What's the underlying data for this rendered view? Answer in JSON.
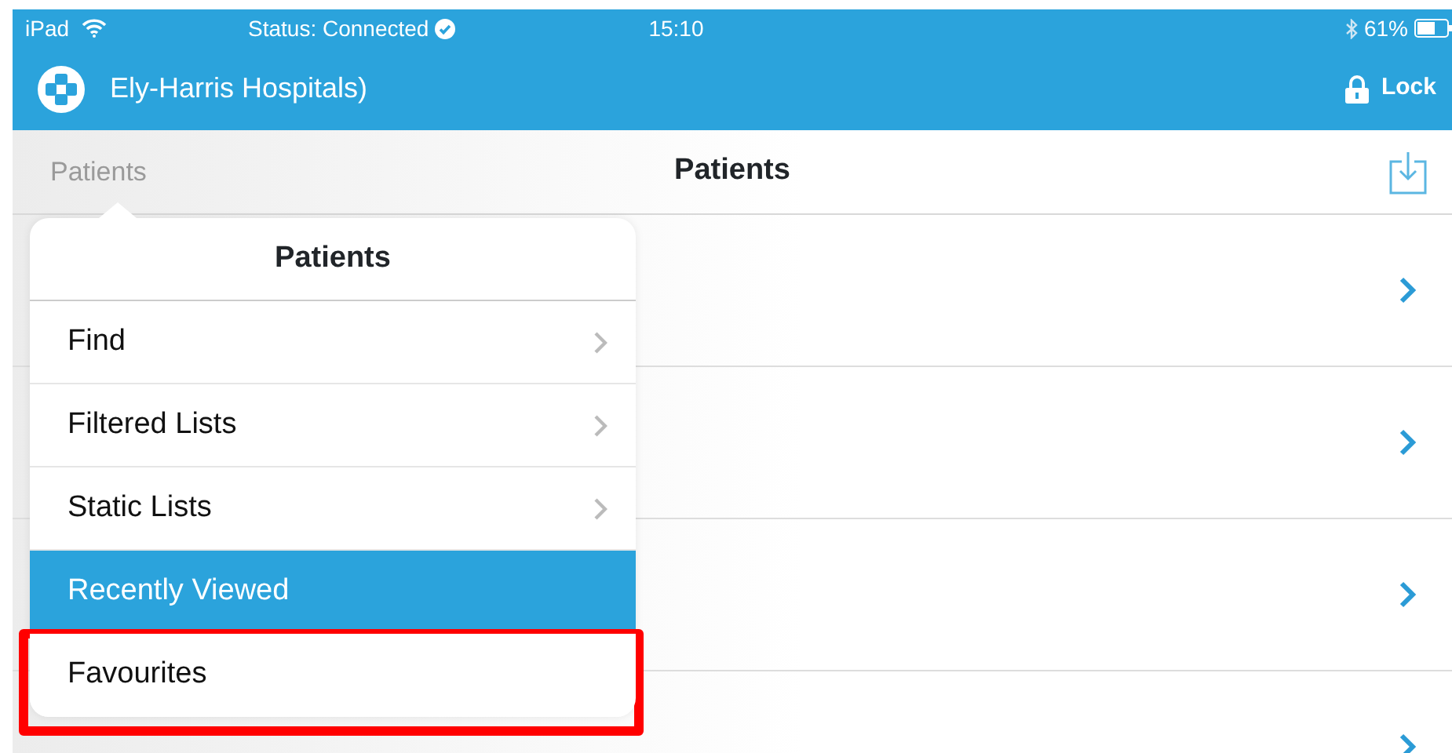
{
  "status_bar": {
    "device": "iPad",
    "status": "Status: Connected",
    "time": "15:10",
    "battery": "61%"
  },
  "header": {
    "title": "Ely-Harris Hospitals)",
    "lock": "Lock"
  },
  "nav": {
    "back": "Patients",
    "title": "Patients"
  },
  "rows": [
    {
      "kind": "disclosure"
    },
    {
      "kind": "disclosure"
    },
    {
      "kind": "disclosure"
    },
    {
      "kind": "disclosure"
    }
  ],
  "popover": {
    "title": "Patients",
    "items": [
      {
        "label": "Find",
        "selected": false,
        "chevron": true,
        "highlighted": false
      },
      {
        "label": "Filtered Lists",
        "selected": false,
        "chevron": true,
        "highlighted": false
      },
      {
        "label": "Static Lists",
        "selected": false,
        "chevron": true,
        "highlighted": false
      },
      {
        "label": "Recently Viewed",
        "selected": true,
        "chevron": false,
        "highlighted": false
      },
      {
        "label": "Favourites",
        "selected": false,
        "chevron": false,
        "highlighted": true
      }
    ]
  }
}
